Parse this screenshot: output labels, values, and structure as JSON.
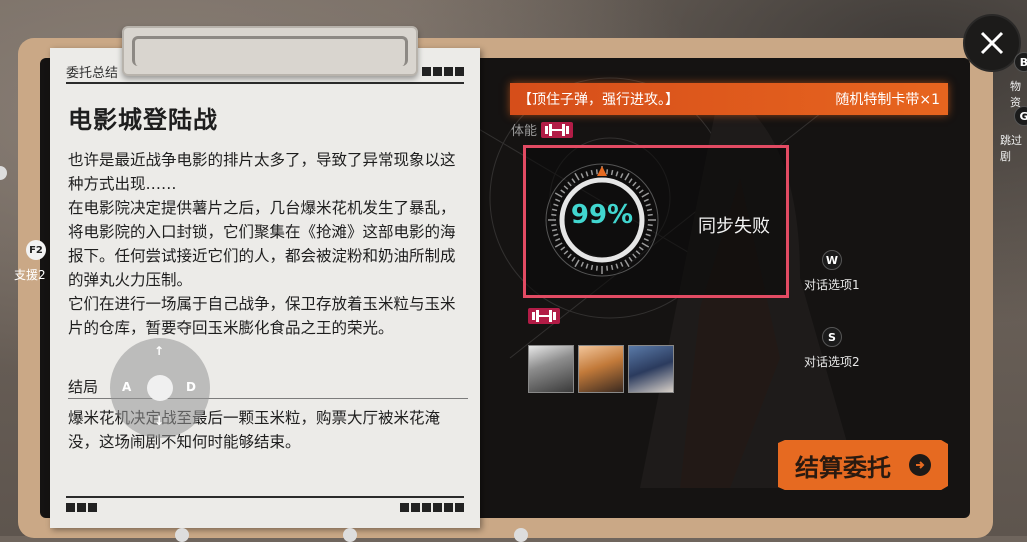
{
  "paper": {
    "header": "委托总结",
    "title": "电影城登陆战",
    "body": [
      "也许是最近战争电影的排片太多了，导致了异常现象以这种方式出现……",
      "在电影院决定提供薯片之后，几台爆米花机发生了暴乱，将电影院的入口封锁，它们聚集在《抢滩》这部电影的海报下。任何尝试接近它们的人，都会被淀粉和奶油所制成的弹丸火力压制。",
      "它们在进行一场属于自己战争，保卫存放着玉米粒与玉米片的仓库，暂要夺回玉米膨化食品之王的荣光。"
    ],
    "section_title": "结局",
    "ending": "爆米花机决定战至最后一颗玉米粒，购票大厅被米花淹没，这场闹剧不知何时能够结束。"
  },
  "dpad": {
    "up": "↑",
    "left": "A",
    "right": "D",
    "down": "↓"
  },
  "hotkeys": {
    "f2_key": "F2",
    "f2_label": "支援2"
  },
  "banner": {
    "text": "【顶住子弹，强行进攻。】",
    "reward": "随机特制卡带×1"
  },
  "stamina": {
    "label": "体能"
  },
  "sync": {
    "value": "99%",
    "percent": 99,
    "status": "同步失败"
  },
  "dialogue": {
    "option1_key": "W",
    "option1_label": "对话选项1",
    "option2_key": "S",
    "option2_label": "对话选项2"
  },
  "settle": {
    "label": "结算委托"
  },
  "edge": {
    "b_key": "B",
    "b_label": "物资",
    "g_key": "G",
    "g_label": "跳过剧"
  },
  "colors": {
    "accent": "#e66a21",
    "sync_border": "#e24b63",
    "gauge_text": "#41d6cf",
    "stamina_icon": "#b21c46"
  }
}
